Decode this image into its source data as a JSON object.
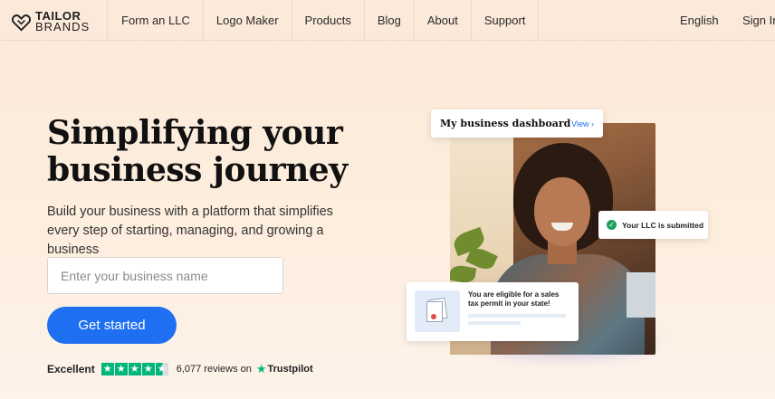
{
  "brand": {
    "line1": "TAILOR",
    "line2": "BRANDS"
  },
  "nav": {
    "items": [
      {
        "label": "Form an LLC"
      },
      {
        "label": "Logo Maker"
      },
      {
        "label": "Products"
      },
      {
        "label": "Blog"
      },
      {
        "label": "About"
      },
      {
        "label": "Support"
      }
    ],
    "language": "English",
    "sign_in": "Sign In"
  },
  "hero": {
    "title": "Simplifying your business journey",
    "subtitle": "Build your business with a platform that simplifies every step of starting, managing, and growing a business",
    "input_placeholder": "Enter your business name",
    "cta_label": "Get started"
  },
  "trustpilot": {
    "label": "Excellent",
    "rating": 4.5,
    "reviews_text": "6,077 reviews on",
    "brand": "Trustpilot",
    "color": "#00b67a"
  },
  "visual": {
    "dashboard_title": "My business dashboard",
    "dashboard_link": "View ›",
    "llc_status": "Your LLC is submitted",
    "tax_message": "You are eligible for a sales tax permit in your state!"
  },
  "colors": {
    "accent": "#1f6ff2",
    "success": "#1ea05f",
    "background": "#fbe9d9"
  }
}
